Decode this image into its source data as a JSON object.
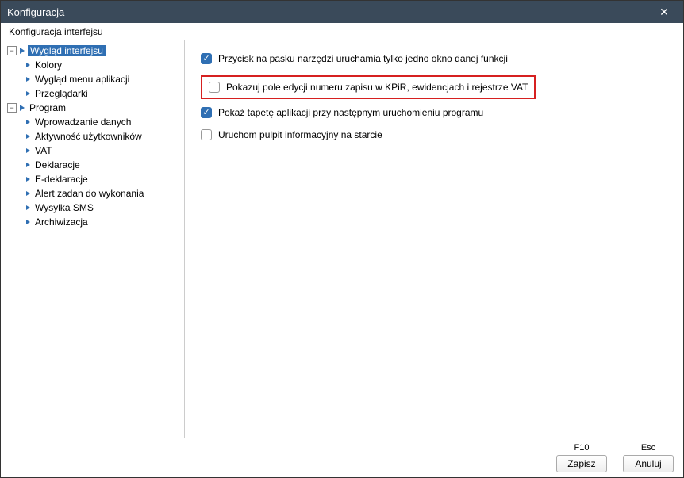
{
  "window": {
    "title": "Konfiguracja",
    "subtitle": "Konfiguracja interfejsu"
  },
  "tree": {
    "wyglad_interfejsu": "Wygląd interfejsu",
    "kolory": "Kolory",
    "wyglad_menu_aplikacji": "Wygląd menu aplikacji",
    "przegladarki": "Przeglądarki",
    "program": "Program",
    "wprowadzanie_danych": "Wprowadzanie danych",
    "aktywnosc_uzytkownikow": "Aktywność użytkowników",
    "vat": "VAT",
    "deklaracje": "Deklaracje",
    "e_deklaracje": "E-deklaracje",
    "alert_zadan": "Alert zadan do wykonania",
    "wysylka_sms": "Wysyłka SMS",
    "archiwizacja": "Archiwizacja"
  },
  "options": {
    "opt1": {
      "label": "Przycisk na pasku narzędzi uruchamia tylko jedno okno danej funkcji",
      "checked": true
    },
    "opt2": {
      "label": "Pokazuj pole edycji numeru zapisu w KPiR, ewidencjach i rejestrze VAT",
      "checked": false,
      "highlighted": true
    },
    "opt3": {
      "label": "Pokaż tapetę aplikacji przy następnym uruchomieniu programu",
      "checked": true
    },
    "opt4": {
      "label": "Uruchom pulpit informacyjny na starcie",
      "checked": false
    }
  },
  "footer": {
    "save_shortcut": "F10",
    "cancel_shortcut": "Esc",
    "save_label": "Zapisz",
    "cancel_label": "Anuluj"
  }
}
